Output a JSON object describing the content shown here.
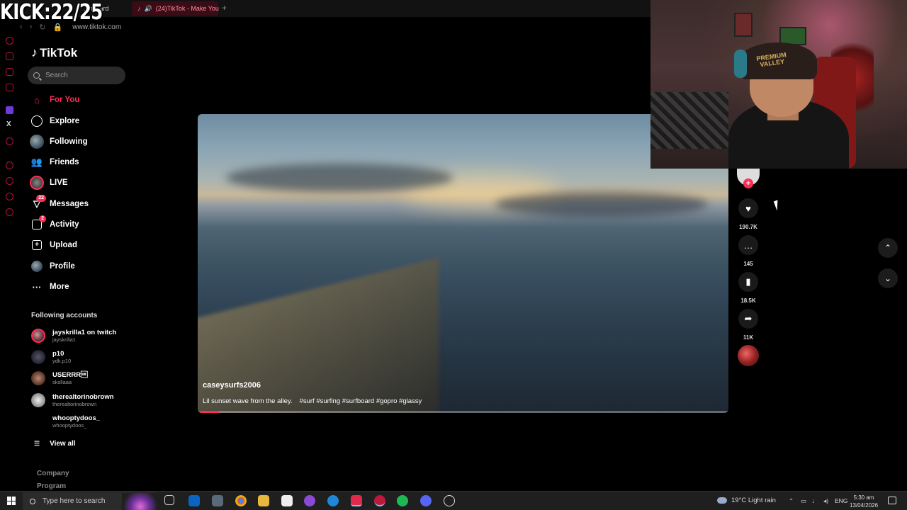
{
  "overlay": {
    "kick_counter": "KICK:22/25"
  },
  "browser": {
    "tabs": [
      {
        "label": "...hboard"
      },
      {
        "label": "(24)TikTok - Make You"
      }
    ],
    "url": "www.tiktok.com"
  },
  "tiktok": {
    "logo": "TikTok",
    "search_placeholder": "Search",
    "nav": [
      {
        "label": "For You",
        "icon": "home-icon"
      },
      {
        "label": "Explore",
        "icon": "compass-icon"
      },
      {
        "label": "Following",
        "icon": "avatar-icon"
      },
      {
        "label": "Friends",
        "icon": "friends-icon"
      },
      {
        "label": "LIVE",
        "icon": "live-icon"
      },
      {
        "label": "Messages",
        "icon": "message-icon",
        "badge": "22"
      },
      {
        "label": "Activity",
        "icon": "activity-icon",
        "badge": "2"
      },
      {
        "label": "Upload",
        "icon": "upload-icon"
      },
      {
        "label": "Profile",
        "icon": "profile-icon"
      },
      {
        "label": "More",
        "icon": "more-icon"
      }
    ],
    "following_title": "Following accounts",
    "accounts": [
      {
        "name": "jayskrilla1 on twitch",
        "handle": "jayskrilla1"
      },
      {
        "name": "p10",
        "handle": "ydk.p10"
      },
      {
        "name": "USERRR\u001f",
        "handle": "sksllaaa"
      },
      {
        "name": "therealtorinobrown",
        "handle": "therealtorinobrown"
      },
      {
        "name": "whooptydoos_",
        "handle": "whooptydoos_"
      }
    ],
    "view_all": "View all",
    "footer": {
      "company": "Company",
      "program": "Program"
    },
    "video": {
      "author": "caseysurfs2006",
      "caption": "Lil sunset wave from the alley.",
      "hashtags": "#surf #surfing #surfboard #gopro #glassy",
      "progress": 0.04
    },
    "actions": {
      "likes": "190.7K",
      "comments": "145",
      "saves": "18.5K",
      "shares": "11K"
    }
  },
  "taskbar": {
    "search_placeholder": "Type here to search",
    "weather": "19°C  Light rain",
    "language": "ENG",
    "time": "5:30 am",
    "date": "13/04/2026"
  },
  "colors": {
    "accent": "#fe2c55",
    "background": "#000000"
  }
}
